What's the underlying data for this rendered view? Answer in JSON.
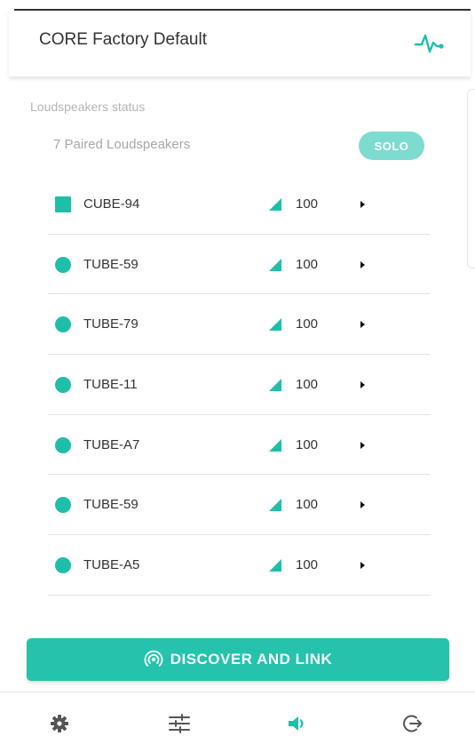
{
  "header": {
    "title": "CORE Factory Default",
    "activity_icon": "activity-pulse-icon"
  },
  "status": {
    "section_label": "Loudspeakers status",
    "paired_count_text": "7 Paired Loudspeakers",
    "solo_label": "SOLO"
  },
  "speakers": [
    {
      "name": "CUBE-94",
      "volume": "100",
      "marker": "square"
    },
    {
      "name": "TUBE-59",
      "volume": "100",
      "marker": "circle"
    },
    {
      "name": "TUBE-79",
      "volume": "100",
      "marker": "circle"
    },
    {
      "name": "TUBE-11",
      "volume": "100",
      "marker": "circle"
    },
    {
      "name": "TUBE-A7",
      "volume": "100",
      "marker": "circle"
    },
    {
      "name": "TUBE-59",
      "volume": "100",
      "marker": "circle"
    },
    {
      "name": "TUBE-A5",
      "volume": "100",
      "marker": "circle"
    }
  ],
  "discover": {
    "label": "DISCOVER AND LINK",
    "icon": "broadcast-icon"
  },
  "nav": {
    "items": [
      {
        "icon": "gear-icon",
        "active": false
      },
      {
        "icon": "sliders-icon",
        "active": false
      },
      {
        "icon": "speaker-icon",
        "active": true
      },
      {
        "icon": "logout-icon",
        "active": false
      }
    ]
  },
  "colors": {
    "accent": "#1dbfa8",
    "button": "#25c2ac",
    "solo": "#7edbd0",
    "muted_text": "#a8a8a8",
    "nav_icon": "#555555"
  }
}
